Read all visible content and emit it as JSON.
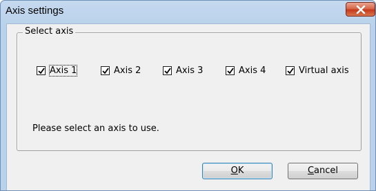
{
  "window": {
    "title": "Axis settings"
  },
  "group": {
    "legend": "Select axis"
  },
  "checkboxes": [
    {
      "label": "Axis 1",
      "checked": true,
      "focused": true
    },
    {
      "label": "Axis 2",
      "checked": true,
      "focused": false
    },
    {
      "label": "Axis 3",
      "checked": true,
      "focused": false
    },
    {
      "label": "Axis 4",
      "checked": true,
      "focused": false
    },
    {
      "label": "Virtual axis",
      "checked": true,
      "focused": false
    }
  ],
  "message": "Please select an axis to use.",
  "buttons": {
    "ok": {
      "mnemonic": "O",
      "rest": "K"
    },
    "cancel": {
      "mnemonic": "C",
      "rest": "ancel"
    }
  },
  "icons": {
    "close": "close-x-icon",
    "check": "checkmark-icon"
  },
  "colors": {
    "close_button": "#c5391b",
    "window_frame": "#b9d1ea",
    "client_area": "#f0f0f0"
  }
}
